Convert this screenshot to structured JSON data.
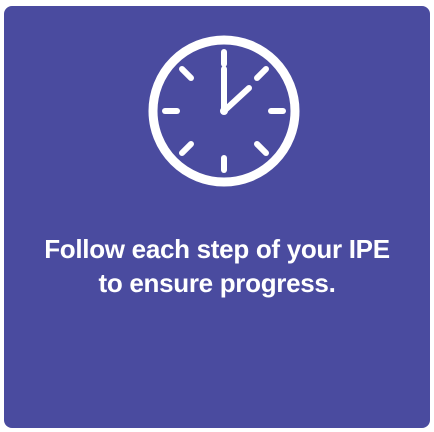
{
  "card": {
    "background": "#4a4b9f",
    "icon": "clock-icon",
    "message_line1": "Follow each step of your IPE",
    "message_line2": "to ensure progress."
  }
}
